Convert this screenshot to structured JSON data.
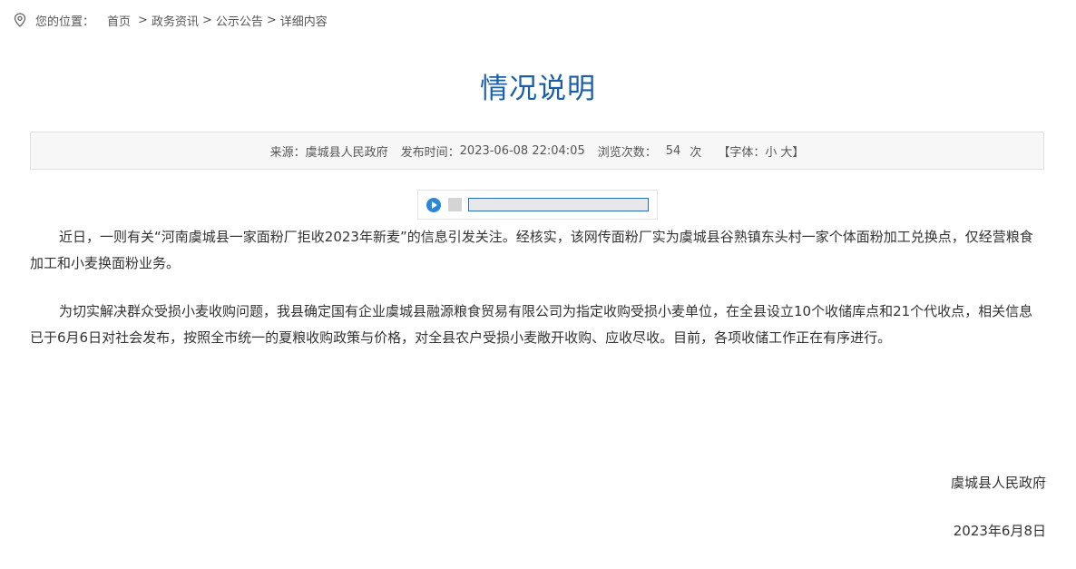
{
  "breadcrumb": {
    "label": "您的位置：",
    "items": [
      "首页",
      "政务资讯",
      "公示公告",
      "详细内容"
    ],
    "separator": ">"
  },
  "article": {
    "title": "情况说明",
    "meta": {
      "source_label": "来源：",
      "source": "虞城县人民政府",
      "time_label": "发布时间：",
      "time": "2023-06-08 22:04:05",
      "views_label": "浏览次数：",
      "views": "54",
      "views_unit": "次",
      "font_label": "【字体：",
      "font_small": "小",
      "font_large": "大",
      "font_close": "】"
    },
    "audio": {
      "progress": 0
    },
    "paragraphs": [
      "近日，一则有关“河南虞城县一家面粉厂拒收2023年新麦”的信息引发关注。经核实，该网传面粉厂实为虞城县谷熟镇东头村一家个体面粉加工兑换点，仅经营粮食加工和小麦换面粉业务。",
      "为切实解决群众受损小麦收购问题，我县确定国有企业虞城县融源粮食贸易有限公司为指定收购受损小麦单位，在全县设立10个收储库点和21个代收点，相关信息已于6月6日对社会发布，按照全市统一的夏粮收购政策与价格，对全县农户受损小麦敞开收购、应收尽收。目前，各项收储工作正在有序进行。"
    ],
    "signature": "虞城县人民政府",
    "date": "2023年6月8日"
  },
  "colors": {
    "accent": "#1a5fa8",
    "player_blue": "#2a86d8"
  },
  "icons": {
    "location": "location-pin-icon",
    "play": "play-icon",
    "stop": "stop-icon"
  }
}
